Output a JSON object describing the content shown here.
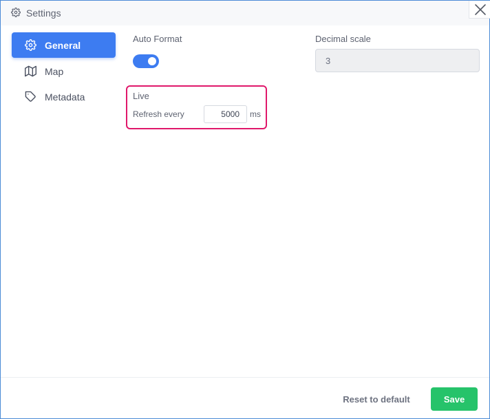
{
  "window": {
    "title": "Settings",
    "title_icon": "gear-icon",
    "close_icon": "close-icon"
  },
  "sidebar": {
    "items": [
      {
        "label": "General",
        "icon": "gear-icon",
        "active": true
      },
      {
        "label": "Map",
        "icon": "map-icon",
        "active": false
      },
      {
        "label": "Metadata",
        "icon": "tag-icon",
        "active": false
      }
    ]
  },
  "general": {
    "auto_format_label": "Auto Format",
    "auto_format_on": true,
    "decimal_scale_label": "Decimal scale",
    "decimal_scale_value": "3",
    "live_label": "Live",
    "refresh_label": "Refresh every",
    "refresh_value": "5000",
    "refresh_unit": "ms"
  },
  "footer": {
    "reset_label": "Reset to default",
    "save_label": "Save"
  },
  "colors": {
    "accent": "#3d7cf1",
    "highlight_border": "#e0176a",
    "save": "#26c36a"
  }
}
